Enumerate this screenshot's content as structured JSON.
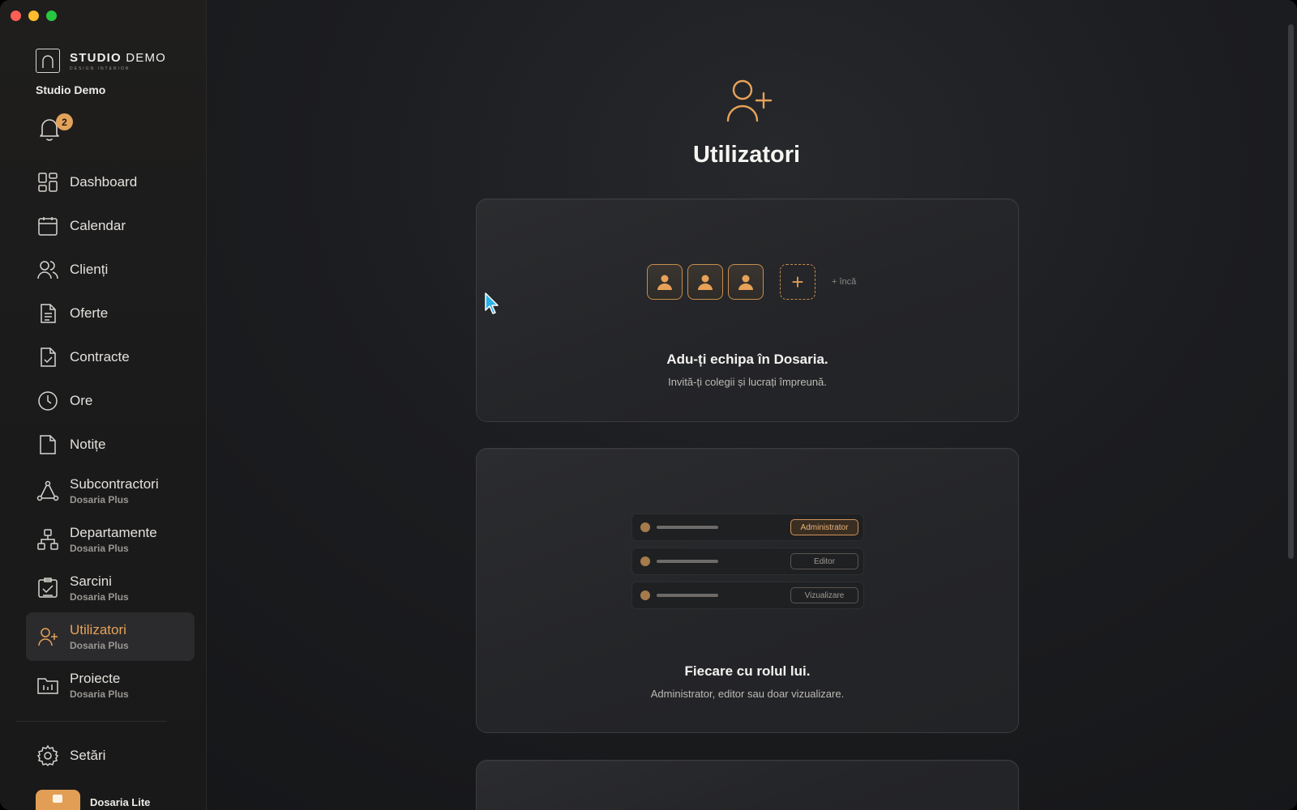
{
  "sidebar": {
    "brand": {
      "name_bold": "STUDIO",
      "name_light": " DEMO",
      "tagline": "DESIGN INTERIOR"
    },
    "studio_name": "Studio Demo",
    "notifications": {
      "count": "2",
      "icon": "bell-icon"
    },
    "items": [
      {
        "label": "Dashboard",
        "icon": "dashboard-icon"
      },
      {
        "label": "Calendar",
        "icon": "calendar-icon"
      },
      {
        "label": "Clienți",
        "icon": "users-icon"
      },
      {
        "label": "Oferte",
        "icon": "document-icon"
      },
      {
        "label": "Contracte",
        "icon": "contract-icon"
      },
      {
        "label": "Ore",
        "icon": "clock-icon"
      },
      {
        "label": "Notițe",
        "icon": "note-icon"
      },
      {
        "label": "Subcontractori",
        "sub": "Dosaria Plus",
        "icon": "network-icon"
      },
      {
        "label": "Departamente",
        "sub": "Dosaria Plus",
        "icon": "org-chart-icon"
      },
      {
        "label": "Sarcini",
        "sub": "Dosaria Plus",
        "icon": "tasks-icon"
      },
      {
        "label": "Utilizatori",
        "sub": "Dosaria Plus",
        "icon": "user-plus-icon",
        "active": true
      },
      {
        "label": "Proiecte",
        "sub": "Dosaria Plus",
        "icon": "folder-icon"
      }
    ],
    "settings_label": "Setări",
    "plan_label": "Dosaria Lite"
  },
  "main": {
    "title": "Utilizatori",
    "card1": {
      "more_label": "+ încă",
      "title": "Adu-ți echipa în Dosaria.",
      "subtitle": "Invită-ți colegii și lucrați împreună."
    },
    "card2": {
      "roles": [
        "Administrator",
        "Editor",
        "Vizualizare"
      ],
      "title": "Fiecare cu rolul lui.",
      "subtitle": "Administrator, editor sau doar vizualizare."
    }
  },
  "colors": {
    "accent": "#e7a259",
    "background": "#1c1d20",
    "card": "#2a2b2e"
  }
}
